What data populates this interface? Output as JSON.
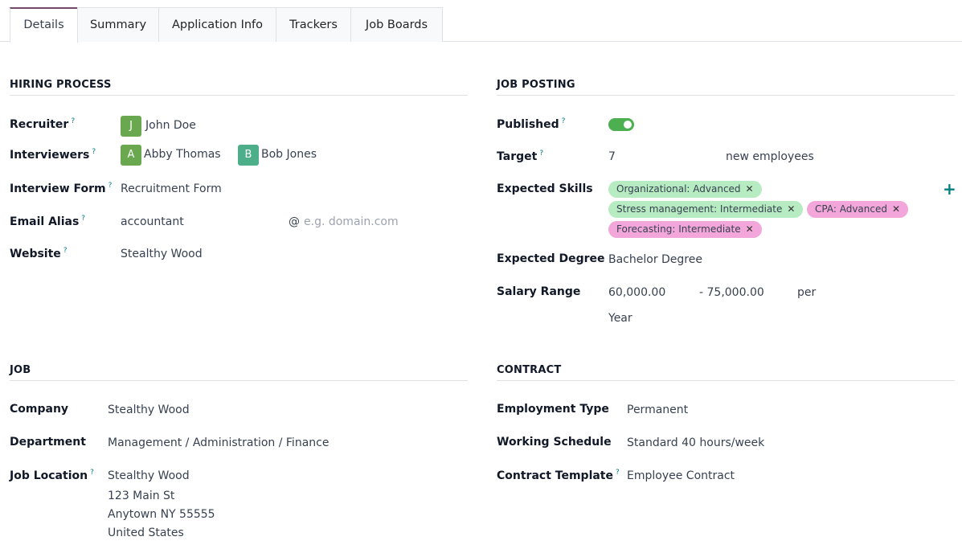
{
  "tabs": [
    "Details",
    "Summary",
    "Application Info",
    "Trackers",
    "Job Boards"
  ],
  "hiring": {
    "title": "HIRING PROCESS",
    "recruiter_label": "Recruiter",
    "recruiter": {
      "initial": "J",
      "name": "John Doe"
    },
    "interviewers_label": "Interviewers",
    "interviewers": [
      {
        "initial": "A",
        "name": "Abby Thomas"
      },
      {
        "initial": "B",
        "name": "Bob Jones"
      }
    ],
    "interview_form_label": "Interview Form",
    "interview_form": "Recruitment Form",
    "email_alias_label": "Email Alias",
    "email_alias": "accountant",
    "email_domain_at": "@",
    "email_domain_placeholder": "e.g. domain.com",
    "website_label": "Website",
    "website": "Stealthy Wood"
  },
  "posting": {
    "title": "JOB POSTING",
    "published_label": "Published",
    "published": true,
    "target_label": "Target",
    "target": "7",
    "target_suffix": "new employees",
    "skills_label": "Expected Skills",
    "skills": [
      {
        "text": "Organizational: Advanced",
        "color": "#b7ebc2"
      },
      {
        "text": "Stress management: Intermediate",
        "color": "#b7ebc2"
      },
      {
        "text": "CPA: Advanced",
        "color": "#f2a6d9"
      },
      {
        "text": "Forecasting: Intermediate",
        "color": "#f2a6d9"
      }
    ],
    "add_icon": "+",
    "degree_label": "Expected Degree",
    "degree": "Bachelor Degree",
    "salary_label": "Salary Range",
    "salary_min": "60,000.00",
    "salary_max": "- 75,000.00",
    "salary_per": "per",
    "salary_period": "Year"
  },
  "job": {
    "title": "JOB",
    "company_label": "Company",
    "company": "Stealthy Wood",
    "department_label": "Department",
    "department": "Management / Administration / Finance",
    "location_label": "Job Location",
    "location": [
      "Stealthy Wood",
      "123 Main St",
      "Anytown NY 55555",
      "United States"
    ]
  },
  "contract": {
    "title": "CONTRACT",
    "employment_type_label": "Employment Type",
    "employment_type": "Permanent",
    "working_schedule_label": "Working Schedule",
    "working_schedule": "Standard 40 hours/week",
    "contract_template_label": "Contract Template",
    "contract_template": "Employee Contract"
  },
  "colors": {
    "accent": "#714b67",
    "avatar_j": "#6aa84f",
    "avatar_a": "#6aa84f",
    "avatar_b": "#4caf8a",
    "help": "#017e84"
  },
  "help_mark": "?"
}
